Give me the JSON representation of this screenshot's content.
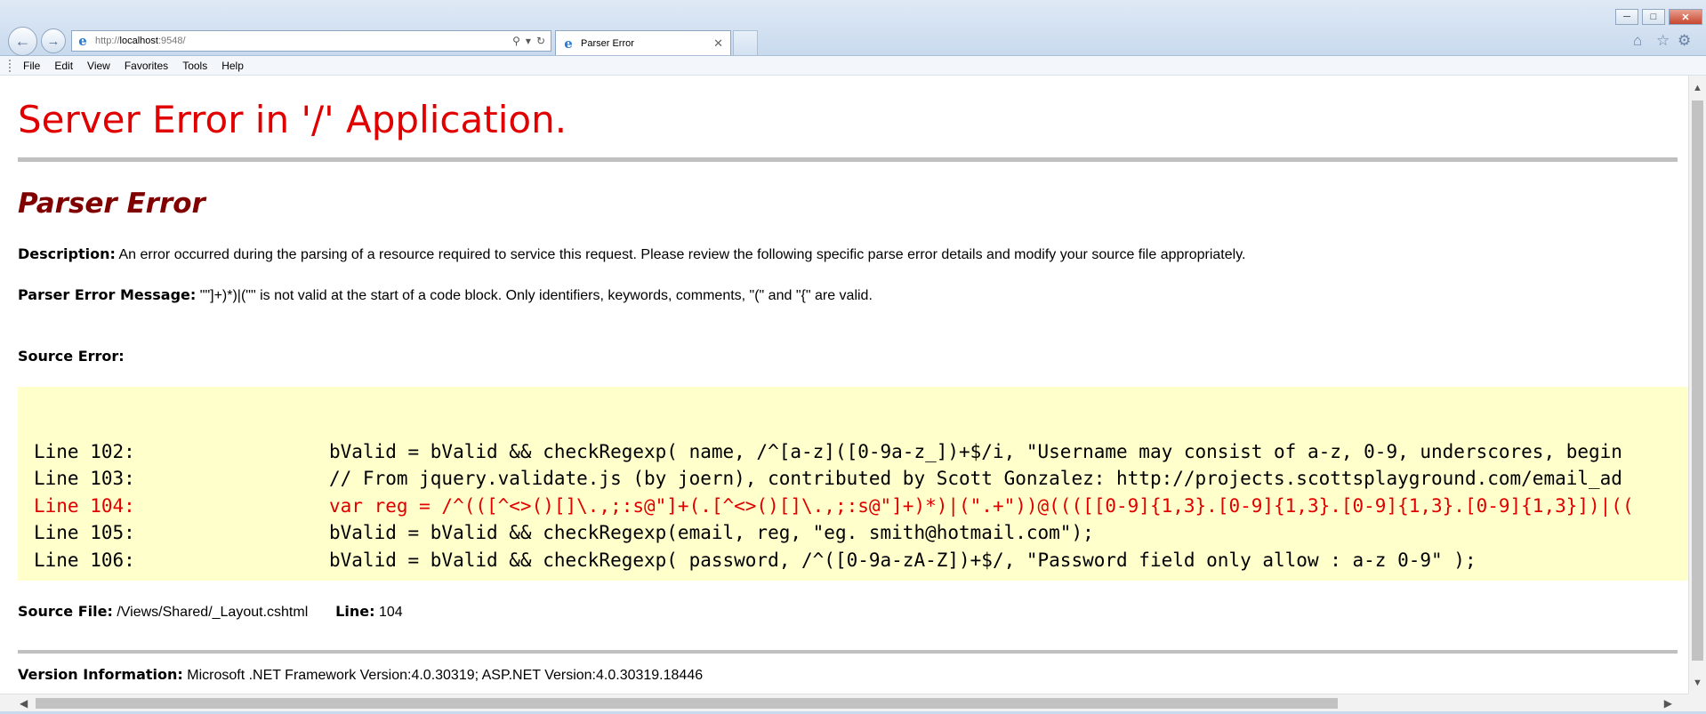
{
  "browser": {
    "url_proto": "http://",
    "url_host": "localhost",
    "url_rest": ":9548/",
    "tab_title": "Parser Error",
    "menu": [
      "File",
      "Edit",
      "View",
      "Favorites",
      "Tools",
      "Help"
    ],
    "icons": {
      "back": "arrow-left",
      "forward": "arrow-right",
      "search": "magnifier",
      "refresh": "refresh",
      "home": "home",
      "favorites": "star",
      "settings": "gear"
    }
  },
  "page": {
    "title": "Server Error in '/' Application.",
    "subtitle": "Parser Error",
    "description_label": "Description:",
    "description_text": "An error occurred during the parsing of a resource required to service this request. Please review the following specific parse error details and modify your source file appropriately.",
    "message_label": "Parser Error Message:",
    "message_text": "\"\"]+)*)|(\"\" is not valid at the start of a code block.  Only identifiers, keywords, comments, \"(\" and \"{\" are valid.",
    "source_error_label": "Source Error:",
    "source_lines": [
      {
        "label": "Line 102:",
        "code": "bValid = bValid && checkRegexp( name, /^[a-z]([0-9a-z_])+$/i, \"Username may consist of a-z, 0-9, underscores, begin"
      },
      {
        "label": "Line 103:",
        "code": "// From jquery.validate.js (by joern), contributed by Scott Gonzalez: http://projects.scottsplayground.com/email_ad"
      },
      {
        "label": "Line 104:",
        "code": "var reg = /^(([^<>()[]\\.,;:s@\"]+(.[^<>()[]\\.,;:s@\"]+)*)|(\".+\"))@((([[0-9]{1,3}.[0-9]{1,3}.[0-9]{1,3}.[0-9]{1,3}])|(("
      },
      {
        "label": "Line 105:",
        "code": "bValid = bValid && checkRegexp(email, reg, \"eg. smith@hotmail.com\");"
      },
      {
        "label": "Line 106:",
        "code": "bValid = bValid && checkRegexp( password, /^([0-9a-zA-Z])+$/, \"Password field only allow : a-z 0-9\" );"
      }
    ],
    "error_line_color": "#e00000",
    "source_file_label": "Source File:",
    "source_file_value": "/Views/Shared/_Layout.cshtml",
    "line_label": "Line:",
    "line_value": "104",
    "version_label": "Version Information:",
    "version_text": "Microsoft .NET Framework Version:4.0.30319; ASP.NET Version:4.0.30319.18446"
  }
}
